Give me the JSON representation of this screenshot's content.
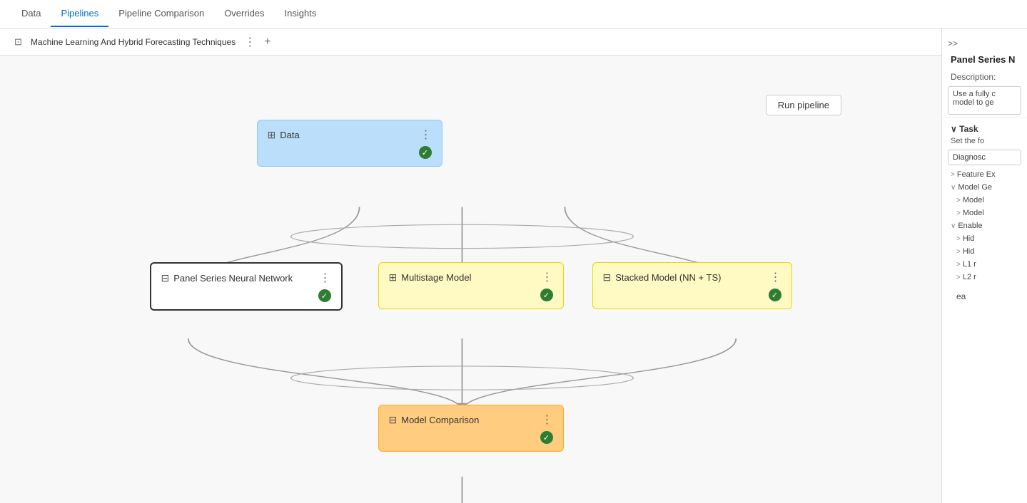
{
  "nav": {
    "tabs": [
      {
        "label": "Data",
        "active": false
      },
      {
        "label": "Pipelines",
        "active": true
      },
      {
        "label": "Pipeline Comparison",
        "active": false
      },
      {
        "label": "Overrides",
        "active": false
      },
      {
        "label": "Insights",
        "active": false
      }
    ]
  },
  "pipeline_tab": {
    "label": "Machine Learning And Hybrid Forecasting Techniques",
    "more_icon": "⋮",
    "add_icon": "+"
  },
  "canvas": {
    "run_button": "Run pipeline",
    "nodes": {
      "data": {
        "title": "Data",
        "icon": "⊞",
        "status": "✓"
      },
      "panel_series": {
        "title": "Panel Series Neural Network",
        "icon": "⊟",
        "status": "✓"
      },
      "multistage": {
        "title": "Multistage Model",
        "icon": "⊞",
        "status": "✓"
      },
      "stacked": {
        "title": "Stacked Model (NN + TS)",
        "icon": "⊟",
        "status": "✓"
      },
      "model_comparison": {
        "title": "Model Comparison",
        "icon": "⊟",
        "status": "✓"
      }
    }
  },
  "right_panel": {
    "collapse_label": ">>",
    "title": "Panel Series N",
    "description_label": "Description:",
    "description_text": "Use a fully c\nmodel to ge",
    "task_section": "Task",
    "task_text": "Set the fo",
    "task_box": "Diagnosc",
    "feature_ex": "Feature Ex",
    "model_gen": "Model Ge",
    "model1": "Model",
    "model2": "Model",
    "enable": "Enable",
    "hid1": "Hid",
    "hid2": "Hid",
    "l1": "L1 r",
    "l2": "L2 r",
    "ea": "ea"
  }
}
